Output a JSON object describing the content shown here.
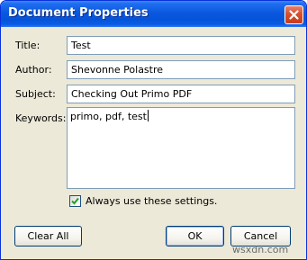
{
  "window": {
    "title": "Document Properties"
  },
  "fields": {
    "title_label": "Title:",
    "title_value": "Test",
    "author_label": "Author:",
    "author_value": "Shevonne Polastre",
    "subject_label": "Subject:",
    "subject_value": "Checking Out Primo PDF",
    "keywords_label": "Keywords:",
    "keywords_value": "primo, pdf, test"
  },
  "options": {
    "always_use_label": "Always use these settings.",
    "always_use_checked": true
  },
  "buttons": {
    "clear_all": "Clear All",
    "ok": "OK",
    "cancel": "Cancel"
  },
  "watermark": "wsxdn.com",
  "icons": {
    "close": "close-icon",
    "check": "checkmark-icon"
  },
  "colors": {
    "titlebar": "#0554d8",
    "dialog_bg": "#ece9d8",
    "close_button": "#d4502e",
    "field_border": "#7f9db9",
    "checkmark": "#21a121"
  }
}
